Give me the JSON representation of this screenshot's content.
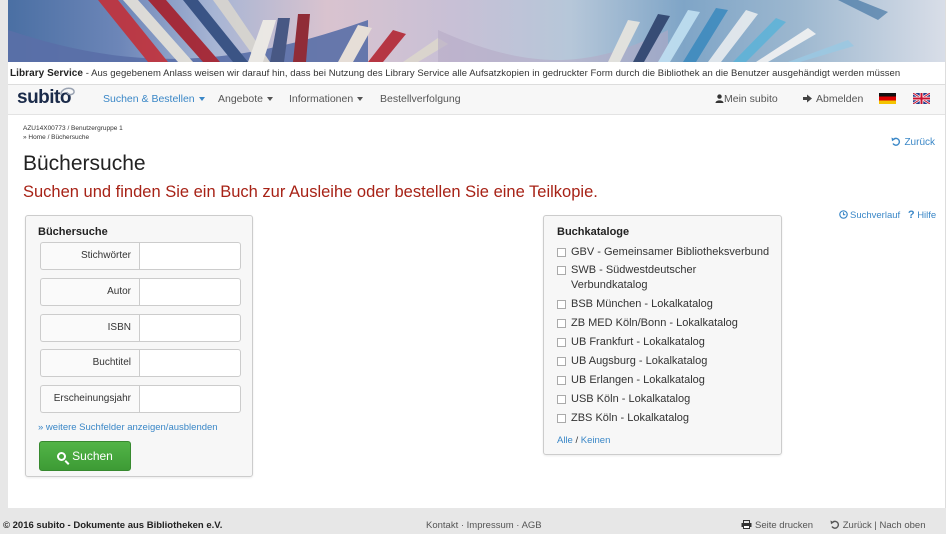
{
  "notice": {
    "title": "Library Service",
    "text": " - Aus gegebenem Anlass weisen wir darauf hin, dass bei Nutzung des Library Service alle Aufsatzkopien in gedruckter Form durch die Bibliothek an die Benutzer ausgehändigt werden müssen"
  },
  "navbar": {
    "logo": "subito",
    "items": [
      {
        "label": "Suchen & Bestellen",
        "dropdown": true
      },
      {
        "label": "Angebote",
        "dropdown": true
      },
      {
        "label": "Informationen",
        "dropdown": true
      },
      {
        "label": "Bestellverfolgung",
        "dropdown": false
      }
    ],
    "my_subito": "Mein subito",
    "logout": "Abmelden"
  },
  "path": {
    "user": "AZU14X00773 / Benutzergruppe 1",
    "breadcrumb": "» Home / Büchersuche"
  },
  "back_label": "Zurück",
  "title": "Büchersuche",
  "subtitle": "Suchen und finden Sie ein Buch zur Ausleihe oder bestellen Sie eine Teilkopie.",
  "history_label": "Suchverlauf",
  "help_label": "Hilfe",
  "search": {
    "heading": "Büchersuche",
    "fields": [
      {
        "label": "Stichwörter",
        "value": ""
      },
      {
        "label": "Autor",
        "value": ""
      },
      {
        "label": "ISBN",
        "value": ""
      },
      {
        "label": "Buchtitel",
        "value": ""
      },
      {
        "label": "Erscheinungsjahr",
        "value": ""
      }
    ],
    "more_fields": "» weitere Suchfelder anzeigen/ausblenden",
    "button": "Suchen"
  },
  "catalogs": {
    "heading": "Buchkataloge",
    "items": [
      "GBV - Gemeinsamer Bibliotheksverbund",
      "SWB - Südwestdeutscher Verbundkatalog",
      "BSB München - Lokalkatalog",
      "ZB MED Köln/Bonn - Lokalkatalog",
      "UB Frankfurt - Lokalkatalog",
      "UB Augsburg - Lokalkatalog",
      "UB Erlangen - Lokalkatalog",
      "USB Köln - Lokalkatalog",
      "ZBS Köln - Lokalkatalog"
    ],
    "all": "Alle",
    "separator": " / ",
    "none": "Keinen"
  },
  "footer": {
    "copyright": "© 2016 subito - Dokumente aus Bibliotheken e.V.",
    "kontakt": "Kontakt",
    "impressum": "Impressum",
    "agb": "AGB",
    "dot": " · ",
    "print": "Seite drucken",
    "back": "Zurück",
    "pipe": " | ",
    "top": "Nach oben"
  },
  "colors": {
    "link": "#3a87c7",
    "subtitle": "#a72216",
    "button": "#45a83c",
    "logo": "#1b2b4a"
  }
}
